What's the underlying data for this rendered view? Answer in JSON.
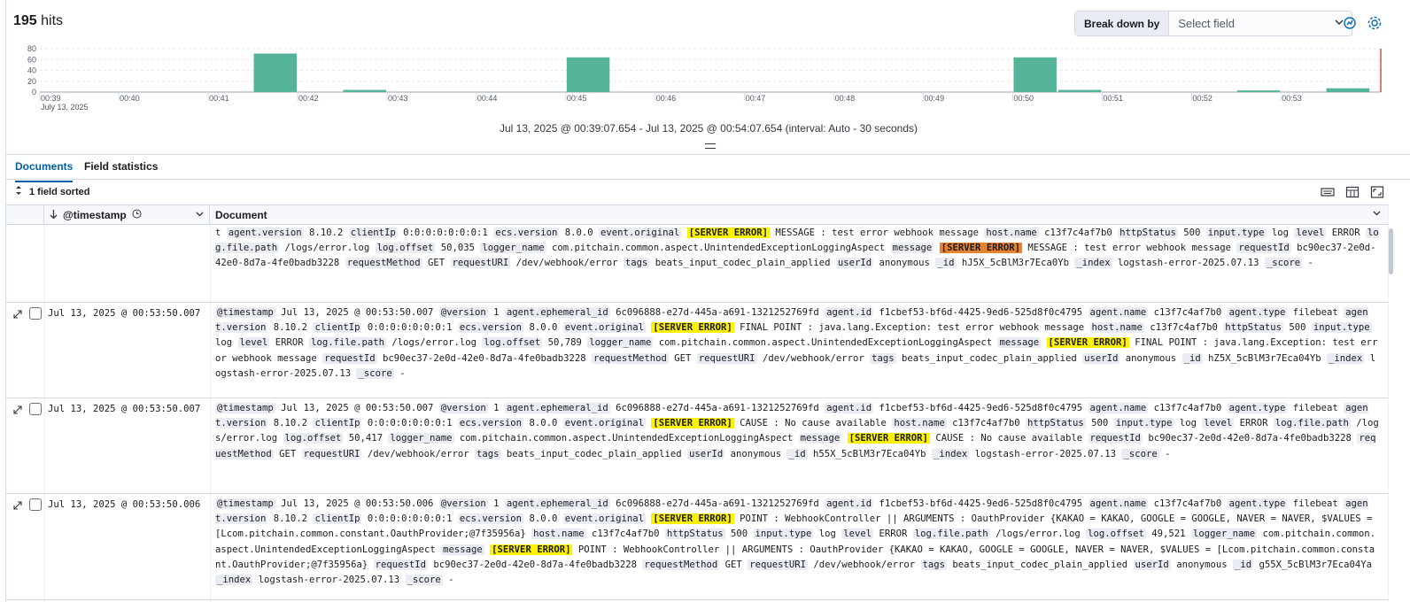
{
  "header": {
    "hits_count": "195",
    "hits_label": " hits",
    "breakdown_label": "Break down by",
    "breakdown_placeholder": "Select field"
  },
  "histogram": {
    "y_ticks": [
      "80",
      "60",
      "40",
      "20",
      "0"
    ],
    "x_ticks": [
      "00:39",
      "00:40",
      "00:41",
      "00:42",
      "00:43",
      "00:44",
      "00:45",
      "00:46",
      "00:47",
      "00:48",
      "00:49",
      "00:50",
      "00:51",
      "00:52",
      "00:53"
    ],
    "date_label": "July 13, 2025",
    "range_text": "Jul 13, 2025 @ 00:39:07.654 - Jul 13, 2025 @ 00:54:07.654 (interval: Auto - 30 seconds)"
  },
  "chart_data": {
    "type": "bar",
    "x": [
      "00:41:30",
      "00:42:30",
      "00:45:00",
      "00:50:00",
      "00:50:30",
      "00:52:30",
      "00:53:30"
    ],
    "values": [
      71,
      4,
      64,
      64,
      4,
      3,
      7
    ],
    "ylim": [
      0,
      80
    ],
    "xlim": [
      "00:39:07",
      "00:54:07"
    ],
    "grid": true,
    "bar_color": "#54b399"
  },
  "tabs": [
    {
      "label": "Documents",
      "active": true
    },
    {
      "label": "Field statistics",
      "active": false
    }
  ],
  "sort": {
    "label": "1 field sorted"
  },
  "grid": {
    "col_timestamp": "@timestamp",
    "col_document": "Document"
  },
  "rows": [
    {
      "timestamp": "",
      "segments": [
        [
          "t ",
          "t"
        ],
        [
          "agent.version",
          "k"
        ],
        [
          " 8.10.2 ",
          "t"
        ],
        [
          "clientIp",
          "k"
        ],
        [
          " 0:0:0:0:0:0:0:1 ",
          "t"
        ],
        [
          "ecs.version",
          "k"
        ],
        [
          " 8.0.0 ",
          "t"
        ],
        [
          "event.original",
          "k"
        ],
        [
          " ",
          "t"
        ],
        [
          "[SERVER ERROR]",
          "hl"
        ],
        [
          " MESSAGE : test error webhook message ",
          "t"
        ],
        [
          "host.name",
          "k"
        ],
        [
          " c13f7c4af7b0 ",
          "t"
        ],
        [
          "httpStatus",
          "k"
        ],
        [
          " 500 ",
          "t"
        ],
        [
          "input.type",
          "k"
        ],
        [
          " log ",
          "t"
        ],
        [
          "level",
          "k"
        ],
        [
          " ERRO",
          "t"
        ],
        [
          "R ",
          "t"
        ],
        [
          "log.file.path",
          "k"
        ],
        [
          " /logs/error.log ",
          "t"
        ],
        [
          "log.offset",
          "k"
        ],
        [
          " 50,035 ",
          "t"
        ],
        [
          "logger_name",
          "k"
        ],
        [
          " com.pitchain.common.aspect.UnintendedExceptionLoggingAspect ",
          "t"
        ],
        [
          "message",
          "k"
        ],
        [
          " ",
          "t"
        ],
        [
          "[SERVER ERROR]",
          "hlo"
        ],
        [
          " MESSAGE : test error webhook message ",
          "t"
        ],
        [
          "requestId",
          "k"
        ],
        [
          " bc90ec37-2e0d-42e0-8d7a-4fe0badb3228 ",
          "t"
        ],
        [
          "requestMethod",
          "k"
        ],
        [
          " GET ",
          "t"
        ],
        [
          "requestURI",
          "k"
        ],
        [
          " /dev/webhook/error ",
          "t"
        ],
        [
          "tags",
          "k"
        ],
        [
          " beats_input_codec_plain_applied ",
          "t"
        ],
        [
          "userId",
          "k"
        ],
        [
          " anonymous ",
          "t"
        ],
        [
          "_id",
          "k"
        ],
        [
          " hJ5X_5cBlM3r7Eca0Yb ",
          "t"
        ],
        [
          "_index",
          "k"
        ],
        [
          " logstash-error-2025.07.13 ",
          "t"
        ],
        [
          "_score",
          "k"
        ],
        [
          " -",
          "t"
        ]
      ]
    },
    {
      "timestamp": "Jul 13, 2025 @ 00:53:50.007",
      "segments": [
        [
          "@timestamp",
          "k"
        ],
        [
          " Jul 13, 2025 @ 00:53:50.007 ",
          "t"
        ],
        [
          "@version",
          "k"
        ],
        [
          " 1 ",
          "t"
        ],
        [
          "agent.ephemeral_id",
          "k"
        ],
        [
          " 6c096888-e27d-445a-a691-1321252769fd ",
          "t"
        ],
        [
          "agent.id",
          "k"
        ],
        [
          " f1cbef53-bf6d-4425-9ed6-525d8f0c4795 ",
          "t"
        ],
        [
          "agent.name",
          "k"
        ],
        [
          " c13f7c4af7b0 ",
          "t"
        ],
        [
          "agent.type",
          "k"
        ],
        [
          " filebeat ",
          "t"
        ],
        [
          "agent.version",
          "k"
        ],
        [
          " 8.10.2 ",
          "t"
        ],
        [
          "clientIp",
          "k"
        ],
        [
          " 0:0:0:0:0:0:0:1 ",
          "t"
        ],
        [
          "ecs.version",
          "k"
        ],
        [
          " 8.0.0 ",
          "t"
        ],
        [
          "event.original",
          "k"
        ],
        [
          " ",
          "t"
        ],
        [
          "[SERVER ERROR]",
          "hl"
        ],
        [
          " FINAL POINT : java.lang.Exception: test error webhook message ",
          "t"
        ],
        [
          "host.name",
          "k"
        ],
        [
          " c13f7c4af7b0 ",
          "t"
        ],
        [
          "httpStatus",
          "k"
        ],
        [
          " 500 ",
          "t"
        ],
        [
          "input.type",
          "k"
        ],
        [
          " log ",
          "t"
        ],
        [
          "level",
          "k"
        ],
        [
          " ERROR ",
          "t"
        ],
        [
          "log.file.path",
          "k"
        ],
        [
          " /logs/error.log ",
          "t"
        ],
        [
          "log.offset",
          "k"
        ],
        [
          " 50,789 ",
          "t"
        ],
        [
          "logger_name",
          "k"
        ],
        [
          " com.pitchain.common.aspect.UnintendedExceptionLoggingAspect ",
          "t"
        ],
        [
          "message",
          "k"
        ],
        [
          " ",
          "t"
        ],
        [
          "[SERVER ERROR]",
          "hl"
        ],
        [
          " FINAL POINT : java.lang.Exception: test error webhook message ",
          "t"
        ],
        [
          "requestId",
          "k"
        ],
        [
          " bc90ec37-2e0d-42e0-8d7a-4fe0badb3228 ",
          "t"
        ],
        [
          "requestMethod",
          "k"
        ],
        [
          " GET ",
          "t"
        ],
        [
          "requestURI",
          "k"
        ],
        [
          " /dev/webhook/error ",
          "t"
        ],
        [
          "tags",
          "k"
        ],
        [
          " beats_input_codec_plain_applied ",
          "t"
        ],
        [
          "userId",
          "k"
        ],
        [
          " anonymous ",
          "t"
        ],
        [
          "_id",
          "k"
        ],
        [
          " hZ5X_5cBlM3r7Eca04Yb ",
          "t"
        ],
        [
          "_index",
          "k"
        ],
        [
          " logstash-error-2025.07.13 ",
          "t"
        ],
        [
          "_score",
          "k"
        ],
        [
          " -",
          "t"
        ]
      ]
    },
    {
      "timestamp": "Jul 13, 2025 @ 00:53:50.007",
      "segments": [
        [
          "@timestamp",
          "k"
        ],
        [
          " Jul 13, 2025 @ 00:53:50.007 ",
          "t"
        ],
        [
          "@version",
          "k"
        ],
        [
          " 1 ",
          "t"
        ],
        [
          "agent.ephemeral_id",
          "k"
        ],
        [
          " 6c096888-e27d-445a-a691-1321252769fd ",
          "t"
        ],
        [
          "agent.id",
          "k"
        ],
        [
          " f1cbef53-bf6d-4425-9ed6-525d8f0c4795 ",
          "t"
        ],
        [
          "agent.name",
          "k"
        ],
        [
          " c13f7c4af7b0 ",
          "t"
        ],
        [
          "agent.type",
          "k"
        ],
        [
          " filebeat ",
          "t"
        ],
        [
          "agent.version",
          "k"
        ],
        [
          " 8.10.2 ",
          "t"
        ],
        [
          "clientIp",
          "k"
        ],
        [
          " 0:0:0:0:0:0:0:1 ",
          "t"
        ],
        [
          "ecs.version",
          "k"
        ],
        [
          " 8.0.0 ",
          "t"
        ],
        [
          "event.original",
          "k"
        ],
        [
          " ",
          "t"
        ],
        [
          "[SERVER ERROR]",
          "hl"
        ],
        [
          " CAUSE : No cause available ",
          "t"
        ],
        [
          "host.name",
          "k"
        ],
        [
          " c13f7c4af7b0 ",
          "t"
        ],
        [
          "httpStatus",
          "k"
        ],
        [
          " 500 ",
          "t"
        ],
        [
          "input.type",
          "k"
        ],
        [
          " log ",
          "t"
        ],
        [
          "level",
          "k"
        ],
        [
          " ERROR ",
          "t"
        ],
        [
          "log.file.path",
          "k"
        ],
        [
          " /logs/error.log ",
          "t"
        ],
        [
          "log.offset",
          "k"
        ],
        [
          " 50,417 ",
          "t"
        ],
        [
          "logger_name",
          "k"
        ],
        [
          " com.pitchain.common.aspect.UnintendedExceptionLoggingAspect ",
          "t"
        ],
        [
          "message",
          "k"
        ],
        [
          " ",
          "t"
        ],
        [
          "[SERVER ERROR]",
          "hl"
        ],
        [
          " CAUSE : No cause available ",
          "t"
        ],
        [
          "requestId",
          "k"
        ],
        [
          " bc90ec37-2e0d-42e0-8d7a-4fe0badb3228 ",
          "t"
        ],
        [
          "requestMethod",
          "k"
        ],
        [
          " GET ",
          "t"
        ],
        [
          "requestURI",
          "k"
        ],
        [
          " /dev/webhook/error ",
          "t"
        ],
        [
          "tags",
          "k"
        ],
        [
          " beats_input_codec_plain_applied ",
          "t"
        ],
        [
          "userId",
          "k"
        ],
        [
          " anonymous ",
          "t"
        ],
        [
          "_id",
          "k"
        ],
        [
          " h55X_5cBlM3r7Eca04Yb ",
          "t"
        ],
        [
          "_index",
          "k"
        ],
        [
          " logstash-error-2025.07.13 ",
          "t"
        ],
        [
          "_score",
          "k"
        ],
        [
          " -",
          "t"
        ]
      ]
    },
    {
      "timestamp": "Jul 13, 2025 @ 00:53:50.006",
      "segments": [
        [
          "@timestamp",
          "k"
        ],
        [
          " Jul 13, 2025 @ 00:53:50.006 ",
          "t"
        ],
        [
          "@version",
          "k"
        ],
        [
          " 1 ",
          "t"
        ],
        [
          "agent.ephemeral_id",
          "k"
        ],
        [
          " 6c096888-e27d-445a-a691-1321252769fd ",
          "t"
        ],
        [
          "agent.id",
          "k"
        ],
        [
          " f1cbef53-bf6d-4425-9ed6-525d8f0c4795 ",
          "t"
        ],
        [
          "agent.name",
          "k"
        ],
        [
          " c13f7c4af7b0 ",
          "t"
        ],
        [
          "agent.type",
          "k"
        ],
        [
          " filebeat ",
          "t"
        ],
        [
          "agent.version",
          "k"
        ],
        [
          " 8.10.2 ",
          "t"
        ],
        [
          "clientIp",
          "k"
        ],
        [
          " 0:0:0:0:0:0:0:1 ",
          "t"
        ],
        [
          "ecs.version",
          "k"
        ],
        [
          " 8.0.0 ",
          "t"
        ],
        [
          "event.original",
          "k"
        ],
        [
          " ",
          "t"
        ],
        [
          "[SERVER ERROR]",
          "hl"
        ],
        [
          " POINT : WebhookController || ARGUMENTS : OauthProvider {KAKAO = KAKAO, GOOGLE = GOOGLE, NAVER = NAVER, $VALUES = [Lcom.pitchain.common.constant.OauthProvider;@7f35956a} ",
          "t"
        ],
        [
          "host.name",
          "k"
        ],
        [
          " c13f7c4af7b0 ",
          "t"
        ],
        [
          "httpStatus",
          "k"
        ],
        [
          " 500 ",
          "t"
        ],
        [
          "input.type",
          "k"
        ],
        [
          " log ",
          "t"
        ],
        [
          "level",
          "k"
        ],
        [
          " ERROR ",
          "t"
        ],
        [
          "log.file.path",
          "k"
        ],
        [
          " /logs/error.log ",
          "t"
        ],
        [
          "log.offset",
          "k"
        ],
        [
          " 49,521 ",
          "t"
        ],
        [
          "logger_name",
          "k"
        ],
        [
          " com.pitchain.common.aspect.UnintendedExceptionLoggingAspect ",
          "t"
        ],
        [
          "message",
          "k"
        ],
        [
          " ",
          "t"
        ],
        [
          "[SERVER ERROR]",
          "hl"
        ],
        [
          " POINT : WebhookController || ARGUMENTS : OauthProvider {KAKAO = KAKAO, GOOGLE = GOOGLE, NAVER = NAVER, $VALUES = [Lcom.pitchain.common.constant.OauthProvider;@7f35956a} ",
          "t"
        ],
        [
          "requestId",
          "k"
        ],
        [
          " bc90ec37-2e0d-42e0-8d7a-4fe0badb3228 ",
          "t"
        ],
        [
          "requestMethod",
          "k"
        ],
        [
          " GET ",
          "t"
        ],
        [
          "requestURI",
          "k"
        ],
        [
          " /dev/webhook/error ",
          "t"
        ],
        [
          "tags",
          "k"
        ],
        [
          " beats_input_codec_plain_applied ",
          "t"
        ],
        [
          "userId",
          "k"
        ],
        [
          " anonymous ",
          "t"
        ],
        [
          "_id",
          "k"
        ],
        [
          " g55X_5cBlM3r7Eca04Ya ",
          "t"
        ],
        [
          "_index",
          "k"
        ],
        [
          " logstash-error-2025.07.13 ",
          "t"
        ],
        [
          "_score",
          "k"
        ],
        [
          " -",
          "t"
        ]
      ]
    }
  ]
}
